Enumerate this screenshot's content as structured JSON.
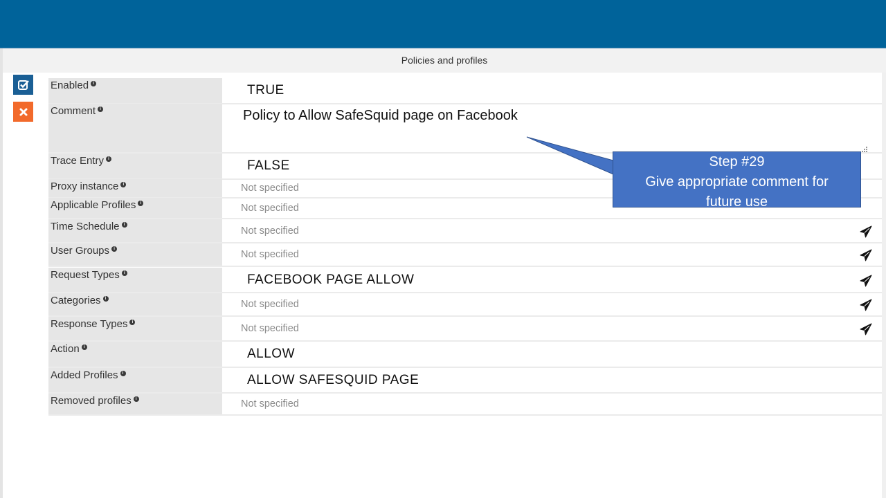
{
  "header": {
    "section_title": "Policies and profiles"
  },
  "side_actions": {
    "save": {
      "icon": "checkbox-icon",
      "color": "#1a5f95"
    },
    "cancel": {
      "icon": "close-icon",
      "color": "#f26a2b"
    }
  },
  "fields": [
    {
      "label": "Enabled",
      "value": "TRUE",
      "type": "value",
      "has_picker": false
    },
    {
      "label": "Comment",
      "value": "Policy to Allow SafeSquid page on Facebook",
      "type": "textarea",
      "has_picker": false
    },
    {
      "label": "Trace Entry",
      "value": "FALSE",
      "type": "value",
      "has_picker": false
    },
    {
      "label": "Proxy instance",
      "value": "Not specified",
      "type": "empty",
      "has_picker": false
    },
    {
      "label": "Applicable Profiles",
      "value": "Not specified",
      "type": "empty",
      "has_picker": false
    },
    {
      "label": "Time Schedule",
      "value": "Not specified",
      "type": "empty",
      "has_picker": true
    },
    {
      "label": "User Groups",
      "value": "Not specified",
      "type": "empty",
      "has_picker": true
    },
    {
      "label": "Request Types",
      "value": "FACEBOOK PAGE ALLOW",
      "type": "value",
      "has_picker": true
    },
    {
      "label": "Categories",
      "value": "Not specified",
      "type": "empty",
      "has_picker": true
    },
    {
      "label": "Response Types",
      "value": "Not specified",
      "type": "empty",
      "has_picker": true
    },
    {
      "label": "Action",
      "value": "ALLOW",
      "type": "value",
      "has_picker": false
    },
    {
      "label": "Added Profiles",
      "value": "ALLOW SAFESQUID PAGE",
      "type": "value",
      "has_picker": false
    },
    {
      "label": "Removed profiles",
      "value": "Not specified",
      "type": "empty",
      "has_picker": false
    }
  ],
  "callout": {
    "line1": "Step #29",
    "line2": "Give appropriate comment for",
    "line3": "future use",
    "color": "#4472c4"
  },
  "colors": {
    "topbar": "#00639a",
    "label_bg": "#e6e6e6",
    "placeholder_text": "#8a8a8a"
  }
}
